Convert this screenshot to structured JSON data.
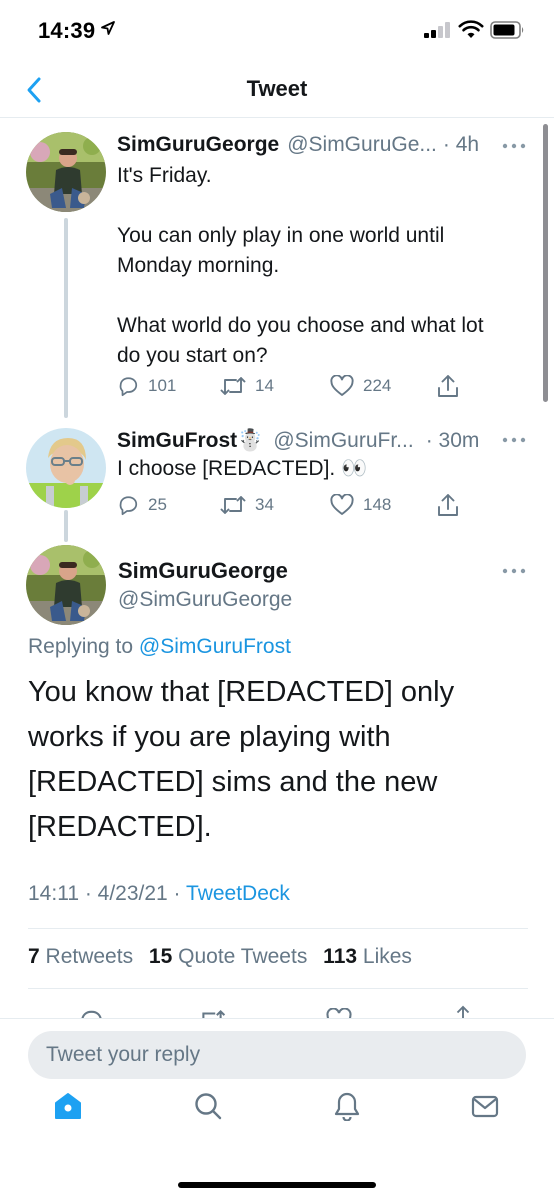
{
  "status_bar": {
    "time": "14:39"
  },
  "header": {
    "title": "Tweet"
  },
  "thread": [
    {
      "name": "SimGuruGeorge",
      "handle": "@SimGuruGe...",
      "time": "· 4h",
      "text": "It's Friday.\n\nYou can only play in one world until\nMonday morning.\n\nWhat world do you choose and what lot\ndo you start on?",
      "replies": "101",
      "retweets": "14",
      "likes": "224"
    },
    {
      "name": "SimGuFrost",
      "name_emoji": "☃️",
      "handle": "@SimGuruFr...",
      "time": "· 30m",
      "text": "I choose [REDACTED]. 👀",
      "replies": "25",
      "retweets": "34",
      "likes": "148"
    }
  ],
  "main_tweet": {
    "name": "SimGuruGeorge",
    "handle": "@SimGuruGeorge",
    "replying_prefix": "Replying to",
    "replying_to": "@SimGuruFrost",
    "text": "You know that [REDACTED] only works if you are playing with [REDACTED] sims and the new [REDACTED].",
    "time": "14:11 · 4/23/21 ·",
    "source": "TweetDeck",
    "retweets_count": "7",
    "retweets_label": "Retweets",
    "quotes_count": "15",
    "quotes_label": "Quote Tweets",
    "likes_count": "113",
    "likes_label": "Likes"
  },
  "reply_bar": {
    "placeholder": "Tweet your reply"
  },
  "colors": {
    "accent": "#1da1f2",
    "text": "#14171a",
    "muted": "#657786"
  },
  "icons": [
    "back-chevron-icon",
    "reply-icon",
    "retweet-icon",
    "like-icon",
    "share-icon",
    "more-icon",
    "home-icon",
    "search-icon",
    "notifications-icon",
    "messages-icon"
  ]
}
